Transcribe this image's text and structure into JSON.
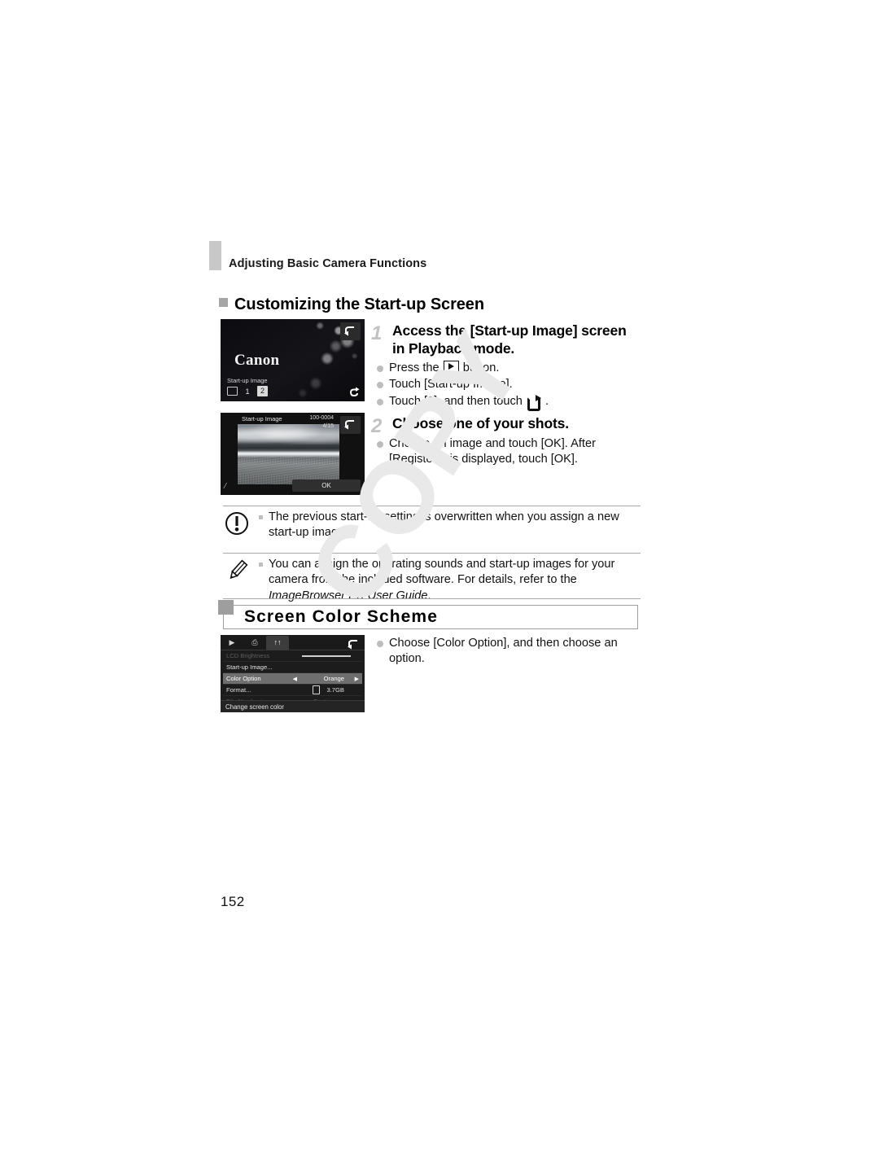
{
  "header": {
    "running_title": "Adjusting Basic Camera Functions"
  },
  "section_customizing": {
    "heading": "Customizing the Start-up Screen",
    "steps": [
      {
        "number": "1",
        "title_line1": "Access the [Start-up Image] screen",
        "title_line2": "in Playback mode.",
        "bullets": [
          {
            "pre": "Press the ",
            "icon": "playback-button-icon",
            "post": " button."
          },
          {
            "pre": "Touch [Start-up Image].",
            "icon": "",
            "post": ""
          },
          {
            "pre": "Touch [2], and then touch ",
            "icon": "register-image-icon",
            "post": " ."
          }
        ]
      },
      {
        "number": "2",
        "title_line1": "Choose one of your shots.",
        "title_line2": "",
        "bullets": [
          {
            "pre": "Choose an image and touch [OK]. After [Register?] is displayed, touch [OK].",
            "icon": "",
            "post": ""
          }
        ]
      }
    ]
  },
  "notices": [
    {
      "icon": "caution-icon",
      "text_parts": [
        {
          "text": "The previous start-up setting is overwritten when you assign a new start-up image.",
          "italic": false
        }
      ]
    },
    {
      "icon": "note-pencil-icon",
      "text_parts": [
        {
          "text": "You can assign the operating sounds and start-up images for your camera from the included software. For details, refer to the ",
          "italic": false
        },
        {
          "text": "ImageBrowser EX User Guide",
          "italic": true
        },
        {
          "text": ".",
          "italic": false
        }
      ]
    }
  ],
  "section_color_scheme": {
    "heading": "Screen Color Scheme",
    "bullets": [
      {
        "pre": "Choose [Color Option], and then choose an option.",
        "icon": "",
        "post": ""
      }
    ]
  },
  "camera_screen_startup": {
    "brand_logo": "Canon",
    "label": "Start-up Image",
    "chip_image_icon": "image-thumbnail-icon",
    "chip_1": "1",
    "chip_2_selected": "2",
    "back_icon": "back-arrow-icon",
    "register_icon": "register-image-icon"
  },
  "camera_screen_chooser": {
    "title": "Start-up Image",
    "folder_icon": "memory-card-icon",
    "file_number": "100-0004",
    "counter": "4/15",
    "ok_label": "OK",
    "back_icon": "back-arrow-icon",
    "mark_icon": "selection-mark-icon"
  },
  "camera_screen_menu": {
    "tabs": [
      {
        "icon": "playback-tab-icon",
        "label": "▶",
        "active": false
      },
      {
        "icon": "print-tab-icon",
        "label": "⎙",
        "active": false
      },
      {
        "icon": "settings-tab-icon",
        "label": "↑↑",
        "active": true
      }
    ],
    "rows": [
      {
        "label": "LCD Brightness",
        "value": "",
        "state": "dim",
        "control": "slider"
      },
      {
        "label": "Start-up Image...",
        "value": "",
        "state": "normal",
        "control": "none"
      },
      {
        "label": "Color Option",
        "value": "Orange",
        "state": "highlight",
        "control": "stepper"
      },
      {
        "label": "Format...",
        "value": "3.7GB",
        "state": "normal",
        "control": "card"
      },
      {
        "label": "File Numbering",
        "value": "Continuous",
        "state": "dim",
        "control": "none"
      }
    ],
    "footer": "Change screen color",
    "back_icon": "back-arrow-icon",
    "arrow_left": "◀",
    "arrow_right": "▶"
  },
  "watermark": {
    "text": "COPY"
  },
  "page_number": "152"
}
